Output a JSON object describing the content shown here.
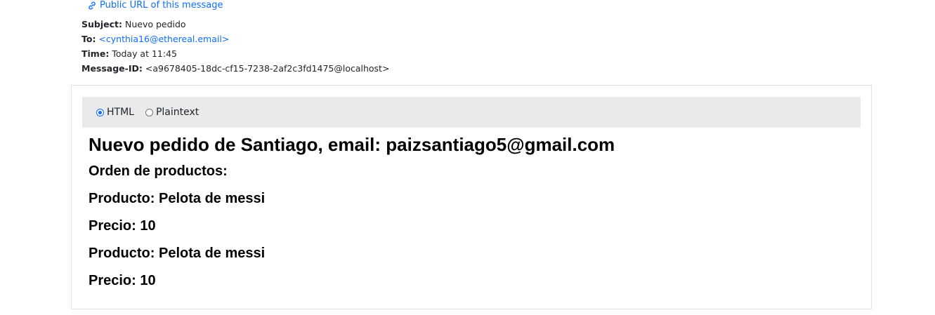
{
  "public_url": {
    "label": "Public URL of this message",
    "icon": "link-icon",
    "color": "#0d6efd"
  },
  "headers": {
    "subject_label": "Subject:",
    "subject_value": "Nuevo pedido",
    "to_label": "To:",
    "to_value": "<cynthia16@ethereal.email>",
    "time_label": "Time:",
    "time_value": "Today at 11:45",
    "message_id_label": "Message-ID:",
    "message_id_value": "<a9678405-18dc-cf15-7238-2af2c3fd1475@localhost>"
  },
  "format_toggle": {
    "options": [
      {
        "label": "HTML",
        "selected": true
      },
      {
        "label": "Plaintext",
        "selected": false
      }
    ]
  },
  "message_body": {
    "heading": "Nuevo pedido de Santiago, email: paizsantiago5@gmail.com",
    "orders_title": "Orden de productos:",
    "items": [
      {
        "product": "Producto: Pelota de messi",
        "price": "Precio: 10"
      },
      {
        "product": "Producto: Pelota de messi",
        "price": "Precio: 10"
      }
    ]
  }
}
